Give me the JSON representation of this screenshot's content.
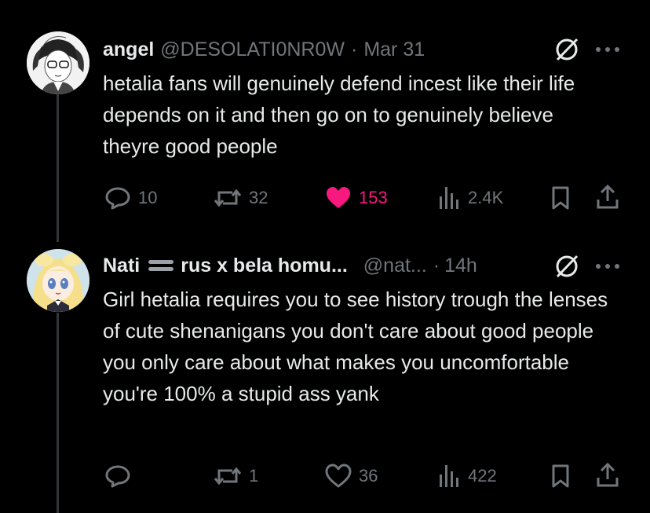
{
  "tweets": [
    {
      "display_name": "angel",
      "handle": "@DESOLATI0NR0W",
      "separator": "·",
      "time": "Mar 31",
      "text": "hetalia fans will genuinely defend incest like their life depends on it and then go on to genuinely believe theyre good people",
      "stats": {
        "replies": "10",
        "reposts": "32",
        "likes": "153",
        "views": "2.4K"
      },
      "liked": true
    },
    {
      "display_name": "Nati",
      "name_suffix": "rus x bela homu...",
      "handle": "@nat...",
      "separator": "·",
      "time": "14h",
      "text": "Girl hetalia requires you to see history trough the lenses of cute shenanigans you don't care about good people you only care about what makes you uncomfortable you're 100% a stupid ass yank",
      "stats": {
        "replies": "",
        "reposts": "1",
        "likes": "36",
        "views": "422"
      },
      "liked": false
    }
  ],
  "colors": {
    "background": "#000000",
    "text": "#e7e9ea",
    "muted": "#71767b",
    "like": "#f91880",
    "thread_line": "#333639"
  },
  "icons": [
    "reply-icon",
    "repost-icon",
    "like-icon",
    "views-icon",
    "bookmark-icon",
    "share-icon",
    "grok-icon",
    "more-icon"
  ]
}
